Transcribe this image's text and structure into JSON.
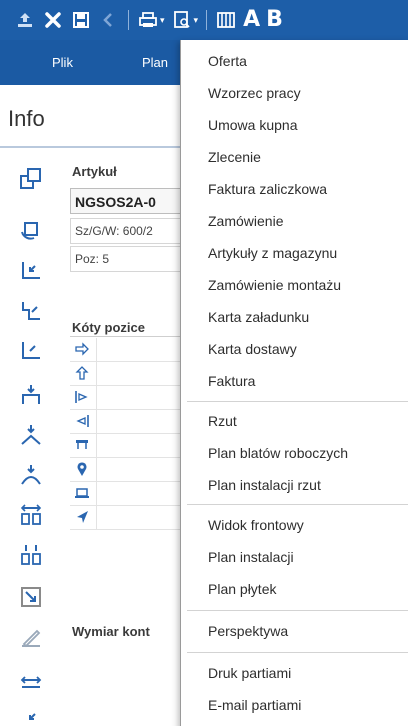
{
  "toolbar": {
    "letters": [
      "A",
      "B"
    ]
  },
  "menubar": {
    "items": [
      {
        "label": "Plik"
      },
      {
        "label": "Plan"
      }
    ]
  },
  "info": {
    "title": "Info"
  },
  "article": {
    "section_label": "Artykuł",
    "code": "NGSOS2A-0",
    "dims": "Sz/G/W: 600/2",
    "position": "Poz: 5"
  },
  "koty": {
    "section_label": "Kóty pozice"
  },
  "wymiar": {
    "section_label": "Wymiar kont"
  },
  "dropdown": {
    "groups": [
      [
        "Oferta",
        "Wzorzec pracy",
        "Umowa kupna",
        "Zlecenie",
        "Faktura zaliczkowa",
        "Zamówienie",
        "Artykuły z magazynu",
        "Zamówienie montażu",
        "Karta załadunku",
        "Karta dostawy",
        "Faktura"
      ],
      [
        "Rzut",
        "Plan blatów roboczych",
        "Plan instalacji rzut"
      ],
      [
        "Widok frontowy",
        "Plan instalacji",
        "Plan płytek"
      ],
      [
        "Perspektywa"
      ],
      [
        "Druk partiami",
        "E-mail partiami"
      ]
    ]
  },
  "colors": {
    "toolbar_bg": "#1d5ea8",
    "menubar_bg": "#1b5aa3",
    "icon_blue": "#2a66b0"
  }
}
